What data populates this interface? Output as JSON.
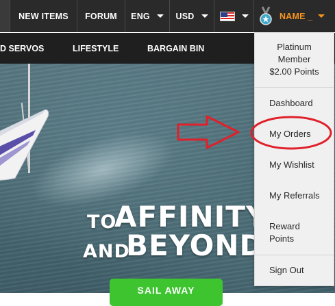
{
  "topnav": {
    "items": [
      {
        "label": "NEW ITEMS"
      },
      {
        "label": "FORUM"
      },
      {
        "label": "ENG"
      },
      {
        "label": "USD"
      }
    ],
    "user_name": "NAME _"
  },
  "subnav": {
    "items": [
      {
        "label": "D SERVOS"
      },
      {
        "label": "LIFESTYLE"
      },
      {
        "label": "BARGAIN BIN"
      }
    ]
  },
  "hero": {
    "line1_small": "TO",
    "line1_big": "AFFINITY",
    "line2_small": "AND",
    "line2_big": "BEYOND",
    "cta_label": "SAIL AWAY"
  },
  "user_menu": {
    "membership_line1": "Platinum",
    "membership_line2": "Member",
    "points": "$2.00 Points",
    "items": [
      {
        "label": "Dashboard"
      },
      {
        "label": "My Orders"
      },
      {
        "label": "My Wishlist"
      },
      {
        "label": "My Referrals"
      },
      {
        "label": "Reward"
      },
      {
        "label": "Points"
      },
      {
        "label": "Sign Out"
      }
    ]
  },
  "colors": {
    "accent_orange": "#f7941d",
    "cta_green": "#3ec42f",
    "annotation_red": "#e0202a"
  }
}
